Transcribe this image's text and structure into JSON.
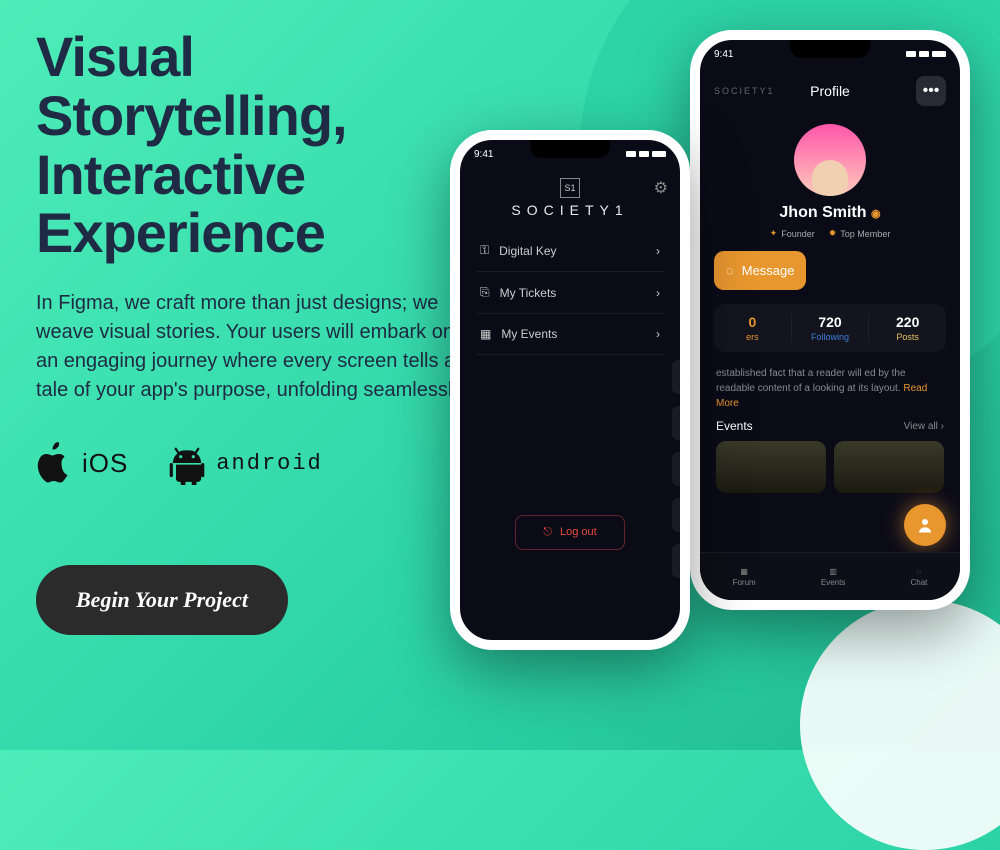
{
  "hero": {
    "headline": "Visual Storytelling, Interactive Experience",
    "body": "In Figma, we craft more than just designs; we weave visual stories. Your users will embark on an engaging journey where every screen tells a tale of your app's purpose, unfolding seamlessly.",
    "platforms": {
      "ios": "iOS",
      "android": "android"
    },
    "cta": "Begin Your Project"
  },
  "phone_front": {
    "time": "9:41",
    "brand": "SOCIETY1",
    "menu": [
      {
        "icon": "key",
        "label": "Digital Key"
      },
      {
        "icon": "ticket",
        "label": "My Tickets"
      },
      {
        "icon": "calendar",
        "label": "My Events"
      }
    ],
    "logout": "Log out"
  },
  "phone_back": {
    "time": "9:41",
    "brand": "SOCIETY1",
    "title": "Profile",
    "username": "Jhon Smith",
    "badges": [
      {
        "icon": "founder",
        "label": "Founder"
      },
      {
        "icon": "star",
        "label": "Top Member"
      }
    ],
    "message_btn": "Message",
    "stats": [
      {
        "num": "0",
        "label": "ers",
        "color": "#e8962e"
      },
      {
        "num": "720",
        "label": "Following",
        "color": "#3d7dd8"
      },
      {
        "num": "220",
        "label": "Posts",
        "color": "#e8c05e"
      }
    ],
    "bio_prefix": "established fact that a reader will ed by the readable content of a looking at its layout.  ",
    "bio_more": "Read More",
    "events_title": "Events",
    "view_all": "View all",
    "nav": [
      {
        "icon": "grid",
        "label": "Forum"
      },
      {
        "icon": "calendar",
        "label": "Events"
      },
      {
        "icon": "chat",
        "label": "Chat"
      }
    ]
  }
}
